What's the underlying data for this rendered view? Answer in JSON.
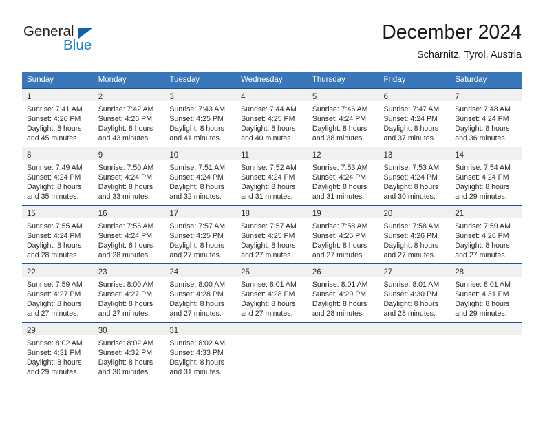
{
  "brand": {
    "name_part1": "General",
    "name_part2": "Blue",
    "triangle_color": "#1464a5",
    "blue_color": "#1d7cc4"
  },
  "header": {
    "title": "December 2024",
    "subtitle": "Scharnitz, Tyrol, Austria"
  },
  "theme": {
    "header_row_bg": "#3a76ba",
    "row_border": "#19549a",
    "daynum_band_bg": "#f0f0f0",
    "text": "#2b2b2b"
  },
  "weekdays": [
    "Sunday",
    "Monday",
    "Tuesday",
    "Wednesday",
    "Thursday",
    "Friday",
    "Saturday"
  ],
  "weeks": [
    [
      {
        "day": "1",
        "sunrise": "Sunrise: 7:41 AM",
        "sunset": "Sunset: 4:26 PM",
        "daylight1": "Daylight: 8 hours",
        "daylight2": "and 45 minutes."
      },
      {
        "day": "2",
        "sunrise": "Sunrise: 7:42 AM",
        "sunset": "Sunset: 4:26 PM",
        "daylight1": "Daylight: 8 hours",
        "daylight2": "and 43 minutes."
      },
      {
        "day": "3",
        "sunrise": "Sunrise: 7:43 AM",
        "sunset": "Sunset: 4:25 PM",
        "daylight1": "Daylight: 8 hours",
        "daylight2": "and 41 minutes."
      },
      {
        "day": "4",
        "sunrise": "Sunrise: 7:44 AM",
        "sunset": "Sunset: 4:25 PM",
        "daylight1": "Daylight: 8 hours",
        "daylight2": "and 40 minutes."
      },
      {
        "day": "5",
        "sunrise": "Sunrise: 7:46 AM",
        "sunset": "Sunset: 4:24 PM",
        "daylight1": "Daylight: 8 hours",
        "daylight2": "and 38 minutes."
      },
      {
        "day": "6",
        "sunrise": "Sunrise: 7:47 AM",
        "sunset": "Sunset: 4:24 PM",
        "daylight1": "Daylight: 8 hours",
        "daylight2": "and 37 minutes."
      },
      {
        "day": "7",
        "sunrise": "Sunrise: 7:48 AM",
        "sunset": "Sunset: 4:24 PM",
        "daylight1": "Daylight: 8 hours",
        "daylight2": "and 36 minutes."
      }
    ],
    [
      {
        "day": "8",
        "sunrise": "Sunrise: 7:49 AM",
        "sunset": "Sunset: 4:24 PM",
        "daylight1": "Daylight: 8 hours",
        "daylight2": "and 35 minutes."
      },
      {
        "day": "9",
        "sunrise": "Sunrise: 7:50 AM",
        "sunset": "Sunset: 4:24 PM",
        "daylight1": "Daylight: 8 hours",
        "daylight2": "and 33 minutes."
      },
      {
        "day": "10",
        "sunrise": "Sunrise: 7:51 AM",
        "sunset": "Sunset: 4:24 PM",
        "daylight1": "Daylight: 8 hours",
        "daylight2": "and 32 minutes."
      },
      {
        "day": "11",
        "sunrise": "Sunrise: 7:52 AM",
        "sunset": "Sunset: 4:24 PM",
        "daylight1": "Daylight: 8 hours",
        "daylight2": "and 31 minutes."
      },
      {
        "day": "12",
        "sunrise": "Sunrise: 7:53 AM",
        "sunset": "Sunset: 4:24 PM",
        "daylight1": "Daylight: 8 hours",
        "daylight2": "and 31 minutes."
      },
      {
        "day": "13",
        "sunrise": "Sunrise: 7:53 AM",
        "sunset": "Sunset: 4:24 PM",
        "daylight1": "Daylight: 8 hours",
        "daylight2": "and 30 minutes."
      },
      {
        "day": "14",
        "sunrise": "Sunrise: 7:54 AM",
        "sunset": "Sunset: 4:24 PM",
        "daylight1": "Daylight: 8 hours",
        "daylight2": "and 29 minutes."
      }
    ],
    [
      {
        "day": "15",
        "sunrise": "Sunrise: 7:55 AM",
        "sunset": "Sunset: 4:24 PM",
        "daylight1": "Daylight: 8 hours",
        "daylight2": "and 28 minutes."
      },
      {
        "day": "16",
        "sunrise": "Sunrise: 7:56 AM",
        "sunset": "Sunset: 4:24 PM",
        "daylight1": "Daylight: 8 hours",
        "daylight2": "and 28 minutes."
      },
      {
        "day": "17",
        "sunrise": "Sunrise: 7:57 AM",
        "sunset": "Sunset: 4:25 PM",
        "daylight1": "Daylight: 8 hours",
        "daylight2": "and 27 minutes."
      },
      {
        "day": "18",
        "sunrise": "Sunrise: 7:57 AM",
        "sunset": "Sunset: 4:25 PM",
        "daylight1": "Daylight: 8 hours",
        "daylight2": "and 27 minutes."
      },
      {
        "day": "19",
        "sunrise": "Sunrise: 7:58 AM",
        "sunset": "Sunset: 4:25 PM",
        "daylight1": "Daylight: 8 hours",
        "daylight2": "and 27 minutes."
      },
      {
        "day": "20",
        "sunrise": "Sunrise: 7:58 AM",
        "sunset": "Sunset: 4:26 PM",
        "daylight1": "Daylight: 8 hours",
        "daylight2": "and 27 minutes."
      },
      {
        "day": "21",
        "sunrise": "Sunrise: 7:59 AM",
        "sunset": "Sunset: 4:26 PM",
        "daylight1": "Daylight: 8 hours",
        "daylight2": "and 27 minutes."
      }
    ],
    [
      {
        "day": "22",
        "sunrise": "Sunrise: 7:59 AM",
        "sunset": "Sunset: 4:27 PM",
        "daylight1": "Daylight: 8 hours",
        "daylight2": "and 27 minutes."
      },
      {
        "day": "23",
        "sunrise": "Sunrise: 8:00 AM",
        "sunset": "Sunset: 4:27 PM",
        "daylight1": "Daylight: 8 hours",
        "daylight2": "and 27 minutes."
      },
      {
        "day": "24",
        "sunrise": "Sunrise: 8:00 AM",
        "sunset": "Sunset: 4:28 PM",
        "daylight1": "Daylight: 8 hours",
        "daylight2": "and 27 minutes."
      },
      {
        "day": "25",
        "sunrise": "Sunrise: 8:01 AM",
        "sunset": "Sunset: 4:28 PM",
        "daylight1": "Daylight: 8 hours",
        "daylight2": "and 27 minutes."
      },
      {
        "day": "26",
        "sunrise": "Sunrise: 8:01 AM",
        "sunset": "Sunset: 4:29 PM",
        "daylight1": "Daylight: 8 hours",
        "daylight2": "and 28 minutes."
      },
      {
        "day": "27",
        "sunrise": "Sunrise: 8:01 AM",
        "sunset": "Sunset: 4:30 PM",
        "daylight1": "Daylight: 8 hours",
        "daylight2": "and 28 minutes."
      },
      {
        "day": "28",
        "sunrise": "Sunrise: 8:01 AM",
        "sunset": "Sunset: 4:31 PM",
        "daylight1": "Daylight: 8 hours",
        "daylight2": "and 29 minutes."
      }
    ],
    [
      {
        "day": "29",
        "sunrise": "Sunrise: 8:02 AM",
        "sunset": "Sunset: 4:31 PM",
        "daylight1": "Daylight: 8 hours",
        "daylight2": "and 29 minutes."
      },
      {
        "day": "30",
        "sunrise": "Sunrise: 8:02 AM",
        "sunset": "Sunset: 4:32 PM",
        "daylight1": "Daylight: 8 hours",
        "daylight2": "and 30 minutes."
      },
      {
        "day": "31",
        "sunrise": "Sunrise: 8:02 AM",
        "sunset": "Sunset: 4:33 PM",
        "daylight1": "Daylight: 8 hours",
        "daylight2": "and 31 minutes."
      },
      {
        "day": "",
        "sunrise": "",
        "sunset": "",
        "daylight1": "",
        "daylight2": ""
      },
      {
        "day": "",
        "sunrise": "",
        "sunset": "",
        "daylight1": "",
        "daylight2": ""
      },
      {
        "day": "",
        "sunrise": "",
        "sunset": "",
        "daylight1": "",
        "daylight2": ""
      },
      {
        "day": "",
        "sunrise": "",
        "sunset": "",
        "daylight1": "",
        "daylight2": ""
      }
    ]
  ]
}
